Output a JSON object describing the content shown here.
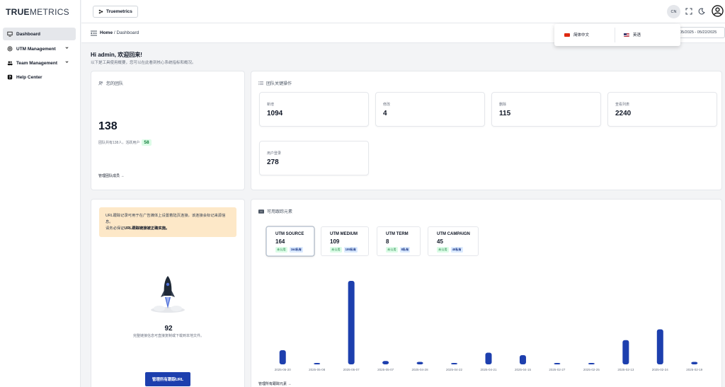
{
  "brand": {
    "bold": "TRUE",
    "light": "METRICS"
  },
  "sidebar": {
    "items": [
      {
        "label": "Dashboard",
        "icon": "monitor-icon"
      },
      {
        "label": "UTM Management",
        "icon": "at-sign-icon"
      },
      {
        "label": "Team Management",
        "icon": "users-icon"
      },
      {
        "label": "Help Center",
        "icon": "help-icon"
      }
    ]
  },
  "topbar": {
    "project": "Truemetrics",
    "lang_code": "CN"
  },
  "breadcrumb": {
    "home": "Home",
    "sep": "/",
    "current": "Dashboard"
  },
  "daterange": "05/2025 - 05/22/2025",
  "lang_menu": {
    "zh": "简体中文",
    "en": "英语"
  },
  "greeting": {
    "title": "Hi admin, 欢迎回来!",
    "subtitle": "以下是工具使用概要，您可以在此看到核心系统指标和概况。"
  },
  "team_card": {
    "title": "您的团队",
    "count": "138",
    "desc": "团队共有138人，活跃用户",
    "active": "58",
    "link": "管理团队成员 →"
  },
  "ops_card": {
    "title": "团队关键操作",
    "stats": [
      {
        "label": "新增",
        "value": "1094"
      },
      {
        "label": "修改",
        "value": "4"
      },
      {
        "label": "删除",
        "value": "115"
      },
      {
        "label": "查看列表",
        "value": "2240"
      },
      {
        "label": "用户登录",
        "value": "278"
      }
    ]
  },
  "url_card": {
    "notice_line1": "URL跟踪记录可用于在广告媒体上设置着陆页连接，该连接会标记来源信息。",
    "notice_line2_pre": "请务必保证",
    "notice_line2_bold": "URL跟踪链接被正确实施。",
    "count": "92",
    "desc": "完整链接信息可直接复制或下载到本地文件。",
    "button": "管理所有跟踪URL"
  },
  "utm_card": {
    "title": "可用跟踪元素",
    "elements": [
      {
        "name": "UTM SOURCE",
        "count": "164",
        "used": "未公用",
        "tag": "164私有"
      },
      {
        "name": "UTM MEDIUM",
        "count": "109",
        "used": "未公用",
        "tag": "109私有"
      },
      {
        "name": "UTM TERM",
        "count": "8",
        "used": "未公用",
        "tag": "8私有"
      },
      {
        "name": "UTM CAMPAIGN",
        "count": "45",
        "used": "未公用",
        "tag": "45私有"
      }
    ],
    "link": "管理所有跟踪元素 →"
  },
  "chart_data": {
    "type": "bar",
    "categories": [
      "2025-05-20",
      "2025-05-08",
      "2025-05-07",
      "2025-05-07",
      "2025-04-28",
      "2025-04-22",
      "2025-04-21",
      "2025-04-15",
      "2025-02-27",
      "2025-02-25",
      "2025-02-13",
      "2025-02-24",
      "2025-02-19"
    ],
    "values": [
      17,
      1,
      100,
      4,
      3,
      1,
      14,
      11,
      1,
      1,
      29,
      42,
      3
    ],
    "ylim": [
      0,
      100
    ],
    "color": "#1d3fae",
    "grid": false
  },
  "colors": {
    "accent": "#1d3fae",
    "notice_bg": "#fde8c8",
    "active_green": "#15803d"
  }
}
